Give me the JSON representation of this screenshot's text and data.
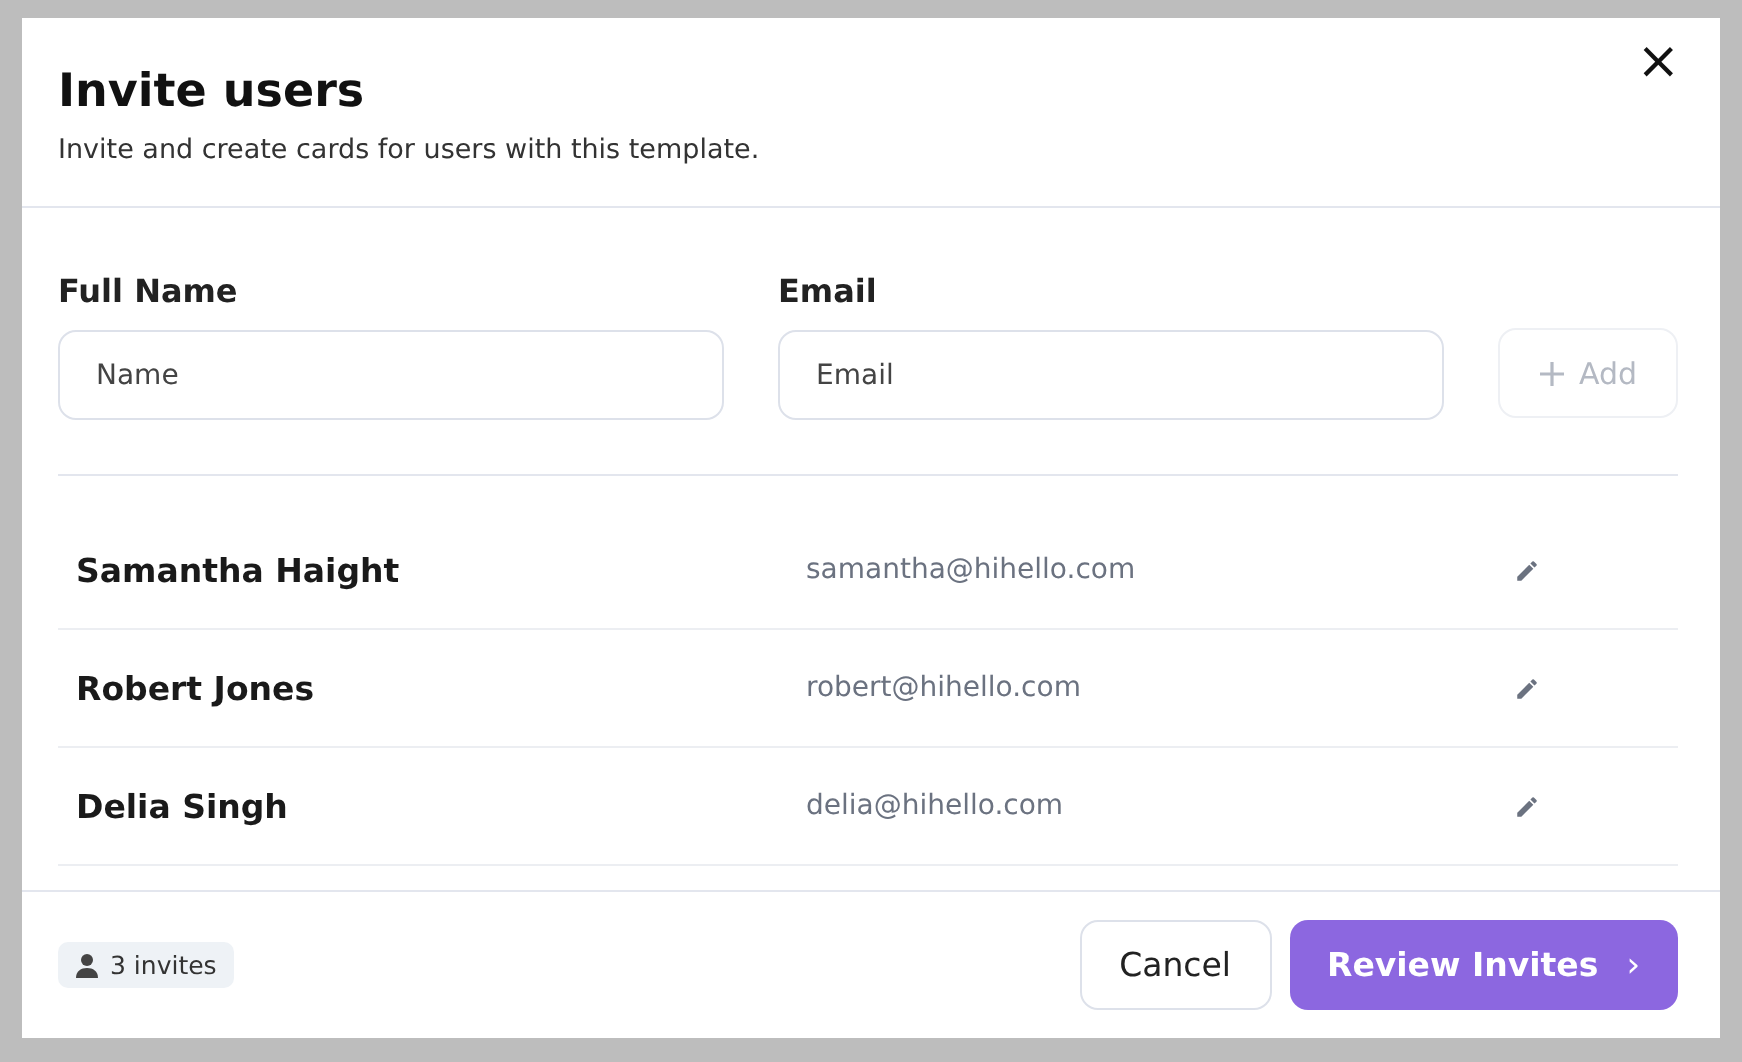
{
  "dialog": {
    "title": "Invite users",
    "subtitle": "Invite and create cards for users with this template.",
    "close": "×"
  },
  "form": {
    "name_label": "Full Name",
    "name_placeholder": "Name",
    "email_label": "Email",
    "email_placeholder": "Email",
    "add_button": {
      "label": "Add",
      "disabled": true
    }
  },
  "invites": [
    {
      "name": "Samantha Haight",
      "email": "samantha@hihello.com"
    },
    {
      "name": "Robert Jones",
      "email": "robert@hihello.com"
    },
    {
      "name": "Delia Singh",
      "email": "delia@hihello.com"
    }
  ],
  "footer": {
    "count": "3 invites",
    "cancel": "Cancel",
    "review": "Review Invites",
    "review_arrow": "›"
  }
}
